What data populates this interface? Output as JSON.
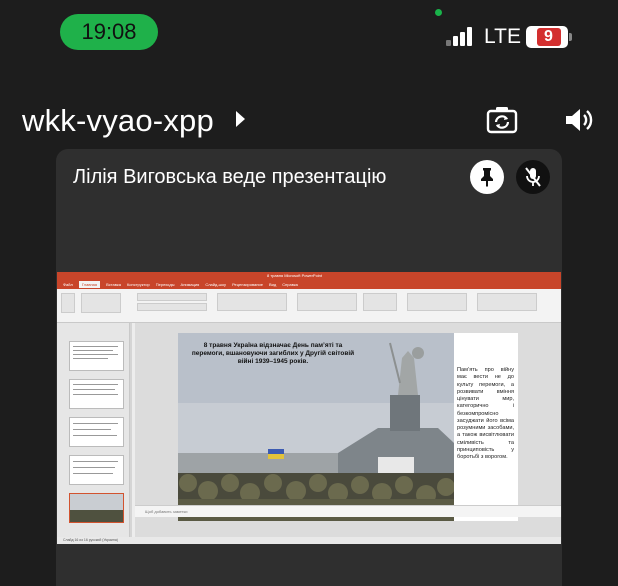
{
  "status_bar": {
    "time": "19:08",
    "network": "LTE",
    "battery": "9",
    "colors": {
      "clock_pill": "#1fb14a",
      "battery_badge": "#d32f2f"
    }
  },
  "meeting": {
    "code": "wkk-vyao-xpp",
    "presenter_caption": "Лілія Виговська веде презентацію",
    "icons": [
      "camera-switch-icon",
      "speaker-icon",
      "pin-icon",
      "mic-off-icon"
    ]
  },
  "presentation": {
    "ribbon_tabs": [
      "Файл",
      "Главная",
      "Вставка",
      "Конструктор",
      "Переходы",
      "Анимация",
      "Слайд-шоу",
      "Рецензирование",
      "Вид",
      "Справка"
    ],
    "active_tab": "Главная",
    "window_title": "8 травня Microsoft PowerPoint",
    "slide_heading": "8 травня Україна відзначає День пам’яті та перемоги, вшановуючи загиблих у Другій світовій війні 1939–1945 років.",
    "slide_body": "Пам’ять про війну має вести не до культу перемоги, а розвивати вміння цінувати мир, категорично і безкомпромісно засуджати його всіма розумними засобами, а також висвітлювати сміливість та принциповість у боротьбі з ворогом.",
    "notes_placeholder": "Щоб добавить заметки",
    "status_text": "Слайд 16 из 16   русский (Украина)"
  }
}
